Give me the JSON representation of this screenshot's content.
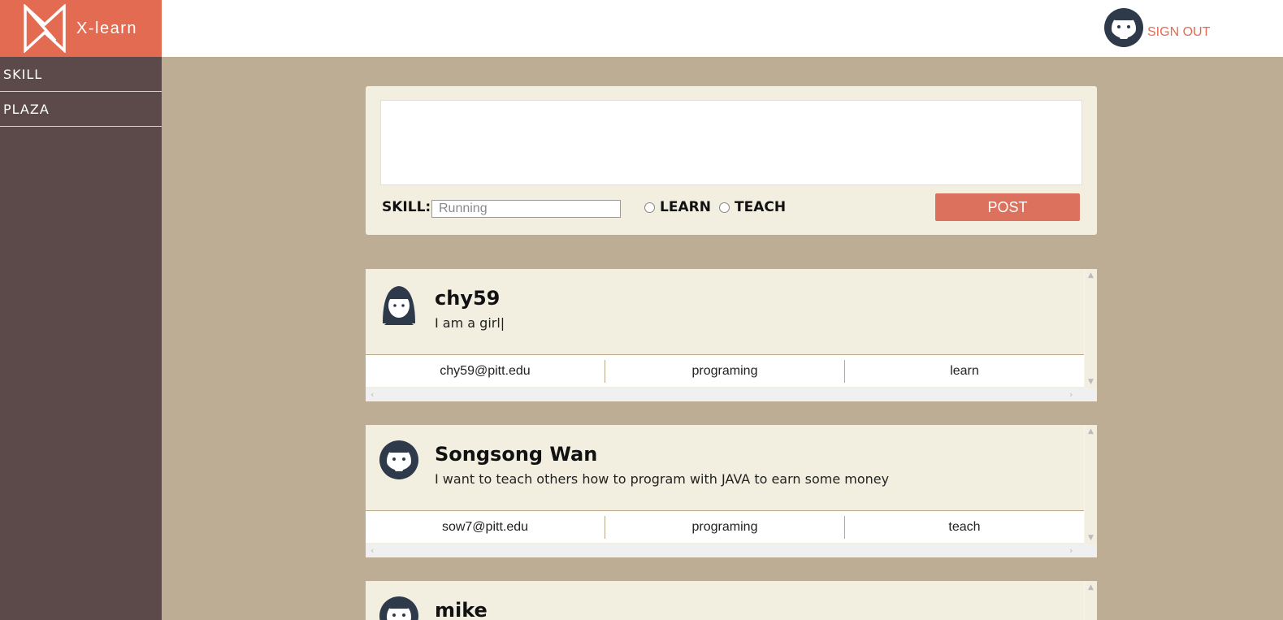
{
  "app": {
    "logo_text": "X-learn"
  },
  "header": {
    "signout_label": "SIGN OUT"
  },
  "sidebar": {
    "items": [
      {
        "label": "SKILL"
      },
      {
        "label": "PLAZA"
      }
    ]
  },
  "composer": {
    "text_value": "",
    "skill_label": "SKILL:",
    "skill_placeholder": "Running",
    "learn_label": "LEARN",
    "teach_label": "TEACH",
    "post_label": "POST"
  },
  "posts": [
    {
      "name": "chy59",
      "message": "I am a girl|",
      "email": "chy59@pitt.edu",
      "skill": "programing",
      "mode": "learn",
      "avatar": "girl-avatar"
    },
    {
      "name": "Songsong Wan",
      "message": "I want to teach others how to program with JAVA to earn some money",
      "email": "sow7@pitt.edu",
      "skill": "programing",
      "mode": "teach",
      "avatar": "bearded-man-avatar"
    },
    {
      "name": "mike",
      "message": "",
      "email": "",
      "skill": "",
      "mode": "",
      "avatar": "bearded-man-avatar"
    }
  ],
  "colors": {
    "brand": "#e36b52",
    "sidebar": "#5b4a49",
    "background": "#bcad94",
    "card": "#f3efe0",
    "avatar": "#2e3a4a"
  }
}
